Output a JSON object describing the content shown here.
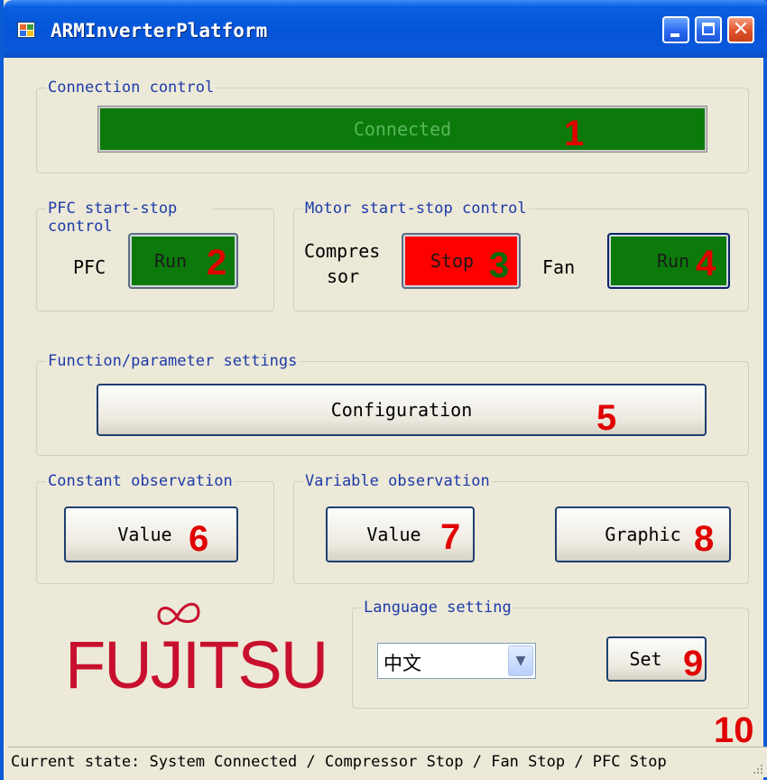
{
  "window": {
    "title": "ARMInverterPlatform"
  },
  "connection_group": {
    "label": "Connection control",
    "status_text": "Connected",
    "marker": "1"
  },
  "pfc_group": {
    "label": "PFC start-stop control",
    "pfc_label": "PFC",
    "pfc_button": "Run",
    "marker": "2"
  },
  "motor_group": {
    "label": "Motor start-stop control",
    "compressor_label_line1": "Compres",
    "compressor_label_line2": "sor",
    "compressor_button": "Stop",
    "compressor_marker": "3",
    "fan_label": "Fan",
    "fan_button": "Run",
    "fan_marker": "4"
  },
  "function_group": {
    "label": "Function/parameter settings",
    "config_button": "Configuration",
    "marker": "5"
  },
  "constant_group": {
    "label": "Constant observation",
    "value_button": "Value",
    "marker": "6"
  },
  "variable_group": {
    "label": "Variable observation",
    "value_button": "Value",
    "value_marker": "7",
    "graphic_button": "Graphic",
    "graphic_marker": "8"
  },
  "language_group": {
    "label": "Language setting",
    "selected_language": "中文",
    "set_button": "Set",
    "marker": "9"
  },
  "logo": {
    "text": "FUJITSU"
  },
  "status": {
    "text": "Current state: System Connected / Compressor Stop / Fan Stop / PFC Stop",
    "marker": "10"
  },
  "colors": {
    "run_green": "#0b7a0b",
    "stop_red": "#ff0000",
    "marker_red": "#e00000",
    "group_label_blue": "#1d3aa8",
    "brand_red": "#c8102e"
  }
}
